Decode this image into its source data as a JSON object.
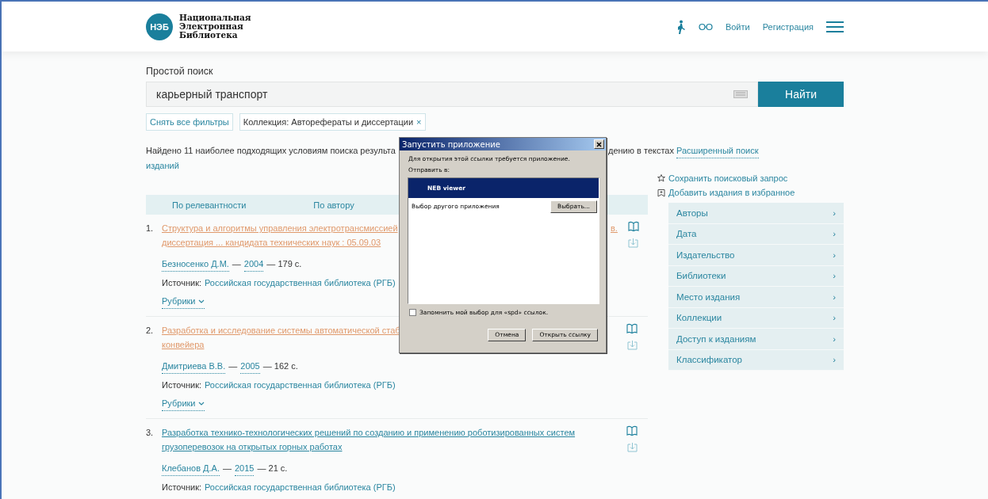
{
  "header": {
    "logo_badge": "НЭБ",
    "logo_lines": [
      "Национальная",
      "Электронная",
      "Библиотека"
    ],
    "login": "Войти",
    "register": "Регистрация"
  },
  "search": {
    "label": "Простой поиск",
    "value": "карьерный транспорт",
    "button": "Найти"
  },
  "filters": {
    "reset": "Снять все фильтры",
    "tags": [
      {
        "label": "Коллекция: Авторефераты и диссертации",
        "remove": "×"
      }
    ]
  },
  "found": {
    "lines": [
      [
        "Найдено 11 наиболее подходящих условиям поиска результа",
        "дению в текстах"
      ],
      [
        "изданий"
      ]
    ],
    "advanced_link": "Расширенный поиск"
  },
  "actions": [
    {
      "kind": "star",
      "label": "Сохранить поисковый запрос"
    },
    {
      "kind": "favorite",
      "label": "Добавить издания в избранное"
    }
  ],
  "sort": [
    "По релевантности",
    "По автору"
  ],
  "results": [
    {
      "number": "1.",
      "visited": true,
      "title_lines": [
        [
          "Структура и алгоритмы управления электротрансмиссией",
          "в."
        ],
        [
          "диссертация ... кандидата технических наук : 05.09.03"
        ]
      ],
      "author": "Безносенко Д.М.",
      "dash": "—",
      "year": "2004",
      "pages": "— 179 с.",
      "source_label": "Источник:",
      "source": "Российская государственная библиотека (РГБ)",
      "rubrics": "Рубрики"
    },
    {
      "number": "2.",
      "visited": true,
      "title_lines": [
        [
          "Разработка и исследование системы автоматической стаб"
        ],
        [
          "конвейера"
        ]
      ],
      "author": "Дмитриева В.В.",
      "dash": "—",
      "year": "2005",
      "pages": "— 162 с.",
      "source_label": "Источник:",
      "source": "Российская государственная библиотека (РГБ)",
      "rubrics": "Рубрики"
    },
    {
      "number": "3.",
      "visited": false,
      "title_lines": [
        [
          "Разработка технико-технологических решений по созданию и применению роботизированных систем"
        ],
        [
          "грузоперевозок на открытых горных работах"
        ]
      ],
      "author": "Клебанов Д.А.",
      "dash": "—",
      "year": "2015",
      "pages": "— 21 с.",
      "source_label": "Источник:",
      "source": "Российская государственная библиотека (РГБ)"
    }
  ],
  "facets": [
    {
      "label": "Авторы",
      "chevron": "›"
    },
    {
      "label": "Дата",
      "chevron": "›"
    },
    {
      "label": "Издательство",
      "chevron": "›"
    },
    {
      "label": "Библиотеки",
      "chevron": "›"
    },
    {
      "label": "Место издания",
      "chevron": "›"
    },
    {
      "label": "Коллекции",
      "chevron": "›"
    },
    {
      "label": "Доступ к изданиям",
      "chevron": "›"
    },
    {
      "label": "Классификатор",
      "chevron": "›"
    }
  ],
  "dialog": {
    "title": "Запустить приложение",
    "message": "Для открытия этой ссылки требуется приложение.",
    "send_to": "Отправить в:",
    "apps": [
      {
        "name": "NEB viewer",
        "selected": true
      }
    ],
    "other_app": "Выбор другого приложения",
    "choose": "Выбрать...",
    "remember": {
      "label": "Запомнить мой выбор для «spd» ссылок.",
      "checked": false
    },
    "buttons": [
      "Отмена",
      "Открыть ссылку"
    ]
  }
}
